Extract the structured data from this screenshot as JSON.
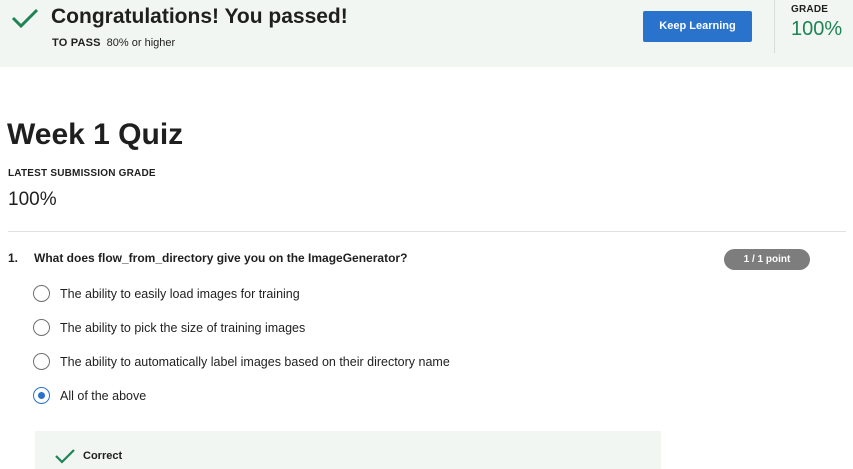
{
  "banner": {
    "title": "Congratulations! You passed!",
    "pass_label": "TO PASS",
    "pass_value": "80% or higher",
    "keep_learning_label": "Keep Learning",
    "grade_label": "GRADE",
    "grade_value": "100%",
    "icon": "check-icon",
    "success_color": "#1f8354"
  },
  "quiz": {
    "title": "Week 1 Quiz",
    "latest_label": "LATEST SUBMISSION GRADE",
    "latest_value": "100%"
  },
  "question": {
    "number": "1.",
    "text": "What does flow_from_directory give you on the ImageGenerator?",
    "points": "1 / 1 point",
    "options": [
      {
        "label": "The ability to easily load images for training",
        "selected": false
      },
      {
        "label": "The ability to pick the size of training images",
        "selected": false
      },
      {
        "label": "The ability to automatically label images based on their directory name",
        "selected": false
      },
      {
        "label": "All of the above",
        "selected": true
      }
    ],
    "feedback": {
      "label": "Correct",
      "icon": "check-icon"
    }
  },
  "colors": {
    "accent": "#2a73cc",
    "success": "#1f8354",
    "banner_bg": "#f1f6f2"
  }
}
